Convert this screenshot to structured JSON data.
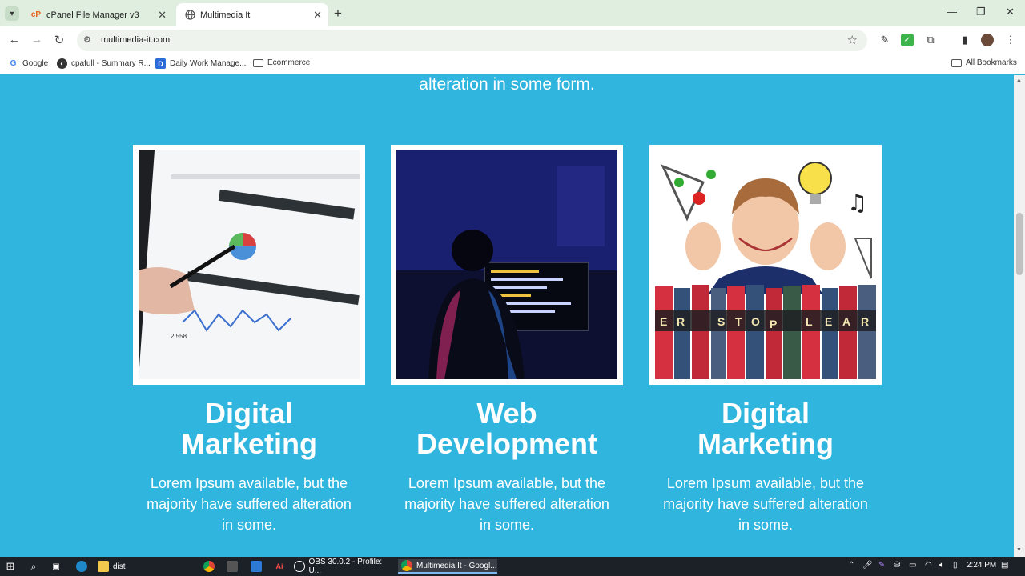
{
  "browser": {
    "tabs": [
      {
        "label": "cPanel File Manager v3",
        "active": false
      },
      {
        "label": "Multimedia It",
        "active": true
      }
    ],
    "url": "multimedia-it.com",
    "bookmarks": [
      {
        "label": "Google"
      },
      {
        "label": "cpafull - Summary R..."
      },
      {
        "label": "Daily Work Manage..."
      },
      {
        "label": "Ecommerce"
      }
    ],
    "all_bookmarks_label": "All Bookmarks"
  },
  "page": {
    "intro_text": "alteration in some form.",
    "cards": [
      {
        "title_line1": "Digital",
        "title_line2": "Marketing",
        "text_line1": "Lorem Ipsum available, but the",
        "text_line2": "majority have suffered alteration",
        "text_line3": "in some.",
        "image": "tablet-analytics-photo"
      },
      {
        "title_line1": "Web",
        "title_line2": "Development",
        "text_line1": "Lorem Ipsum available, but the",
        "text_line2": "majority have suffered alteration",
        "text_line3": "in some.",
        "image": "developer-at-monitor-photo"
      },
      {
        "title_line1": "Digital",
        "title_line2": "Marketing",
        "text_line1": "Lorem Ipsum available, but the",
        "text_line2": "majority have suffered alteration",
        "text_line3": "in some.",
        "image": "girl-with-books-photo",
        "book_letters": [
          "E",
          "R",
          "S",
          "T",
          "O",
          "P",
          "L",
          "E",
          "A",
          "R"
        ]
      }
    ],
    "background_color": "#2fb5de"
  },
  "taskbar": {
    "items": [
      {
        "label": "dist"
      },
      {
        "label": "OBS 30.0.2 - Profile: U..."
      },
      {
        "label": "Multimedia It - Googl...",
        "active": true
      }
    ],
    "clock": "2:24 PM"
  }
}
